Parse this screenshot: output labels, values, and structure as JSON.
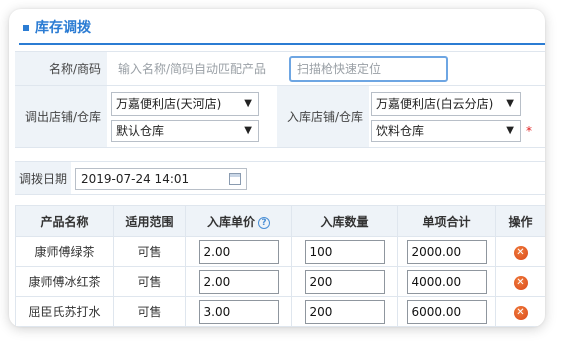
{
  "panel": {
    "title": "库存调拨"
  },
  "form": {
    "name_label": "名称/商码",
    "name_placeholder": "输入名称/简码自动匹配产品",
    "scan_placeholder": "扫描枪快速定位",
    "out_label": "调出店铺/仓库",
    "out_store": "万嘉便利店(天河店)",
    "out_warehouse": "默认仓库",
    "in_label": "入库店铺/仓库",
    "in_store": "万嘉便利店(白云分店)",
    "in_warehouse": "饮料仓库",
    "required_mark": "*",
    "date_label": "调拨日期",
    "date_value": "2019-07-24 14:01"
  },
  "table": {
    "headers": [
      "产品名称",
      "适用范围",
      "入库单价",
      "入库数量",
      "单项合计",
      "操作"
    ],
    "rows": [
      {
        "name": "康师傅绿茶",
        "scope": "可售",
        "price": "2.00",
        "qty": "100",
        "total": "2000.00"
      },
      {
        "name": "康师傅冰红茶",
        "scope": "可售",
        "price": "2.00",
        "qty": "200",
        "total": "4000.00"
      },
      {
        "name": "屈臣氏苏打水",
        "scope": "可售",
        "price": "3.00",
        "qty": "200",
        "total": "6000.00"
      }
    ]
  },
  "icons": {
    "select_arrow": "▼",
    "help": "?",
    "delete": "✕"
  },
  "colors": {
    "accent": "#2b7cd3",
    "header_bg": "#eef3f8",
    "delete": "#e0561f",
    "required": "#e02020"
  }
}
